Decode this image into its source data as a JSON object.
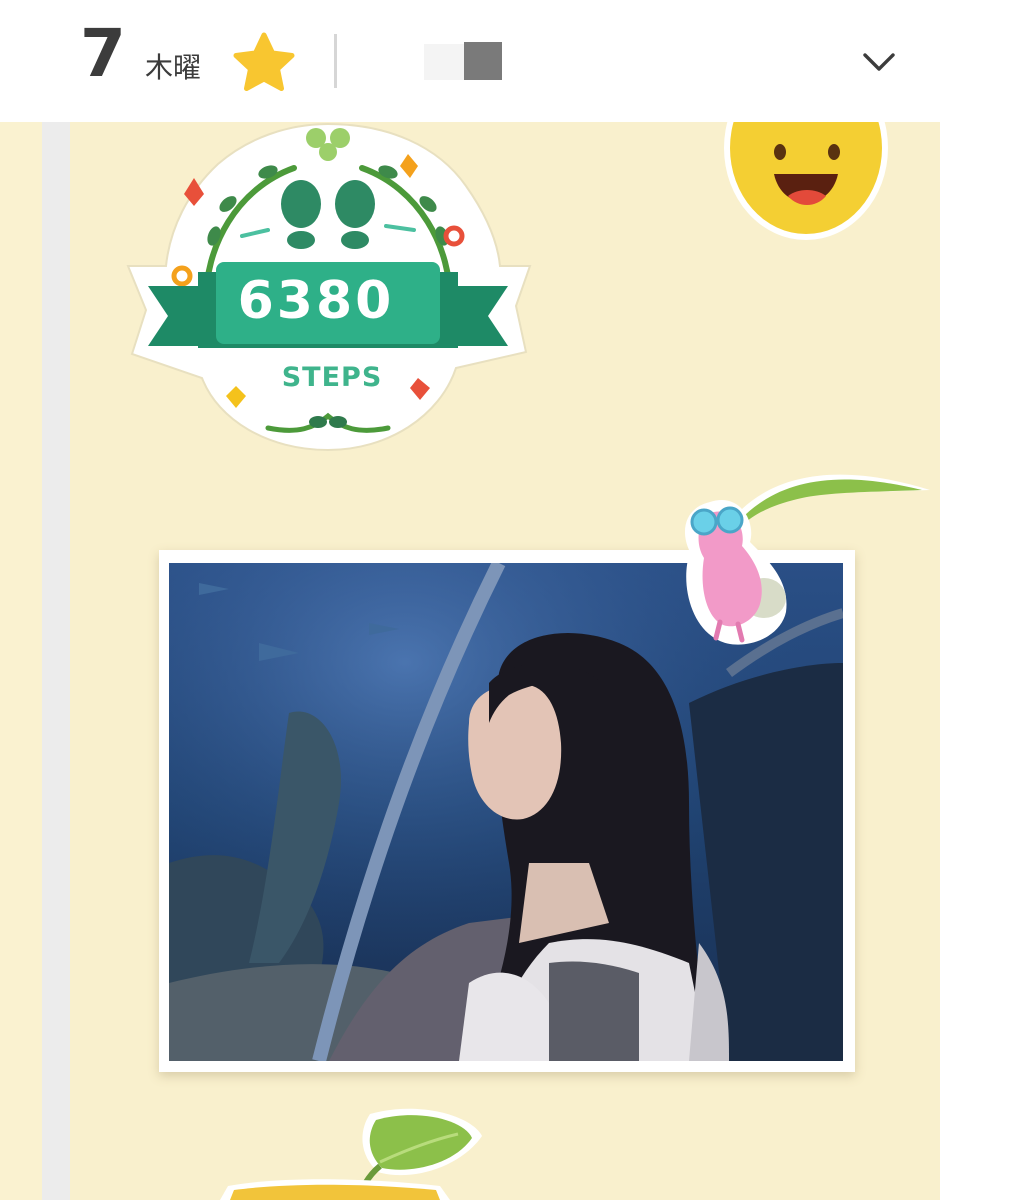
{
  "header": {
    "day_number": "7",
    "weekday": "木曜",
    "star_icon": "star-icon",
    "star_color": "#f8c630",
    "expand_icon": "chevron-down-icon"
  },
  "diary_page": {
    "background_color": "#f9f0cd",
    "steps_sticker": {
      "count": "6380",
      "label": "STEPS",
      "ribbon_color": "#1e8a66"
    },
    "stickers": [
      "smiley-face-icon",
      "pink-pikmin-icon",
      "sprout-leaf-icon"
    ]
  }
}
